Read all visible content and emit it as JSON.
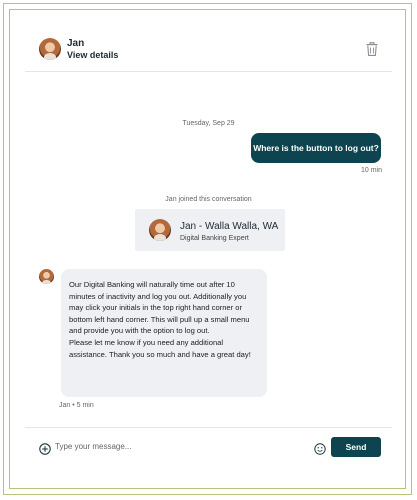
{
  "header": {
    "agent_name": "Jan",
    "details_link": "View details",
    "delete_icon": "trash-icon"
  },
  "conversation": {
    "date_divider": "Tuesday, Sep 29",
    "outgoing": {
      "text": "Where is the button to log out?",
      "time": "10 min"
    },
    "system_note": "Jan joined this conversation",
    "agent_card": {
      "name": "Jan - Walla Walla, WA",
      "role": "Digital Banking Expert"
    },
    "incoming": {
      "paragraph_1": "Our Digital Banking will naturally time out after 10 minutes of inactivity and log you out. Additionally you may click your initials in the top right hand corner or bottom left hand corner. This will pull up a small menu and provide you with the option to log out.",
      "paragraph_2": "Please let me know if you need any additional assistance. Thank you so much and have a great day!",
      "meta": "Jan • 5 min"
    }
  },
  "composer": {
    "placeholder": "Type your message...",
    "send_label": "Send",
    "add_icon": "plus-circle-icon",
    "emoji_icon": "smiley-icon"
  },
  "colors": {
    "accent": "#0d4450",
    "bubble_bg": "#eef0f4",
    "frame": "#b7c27a"
  }
}
